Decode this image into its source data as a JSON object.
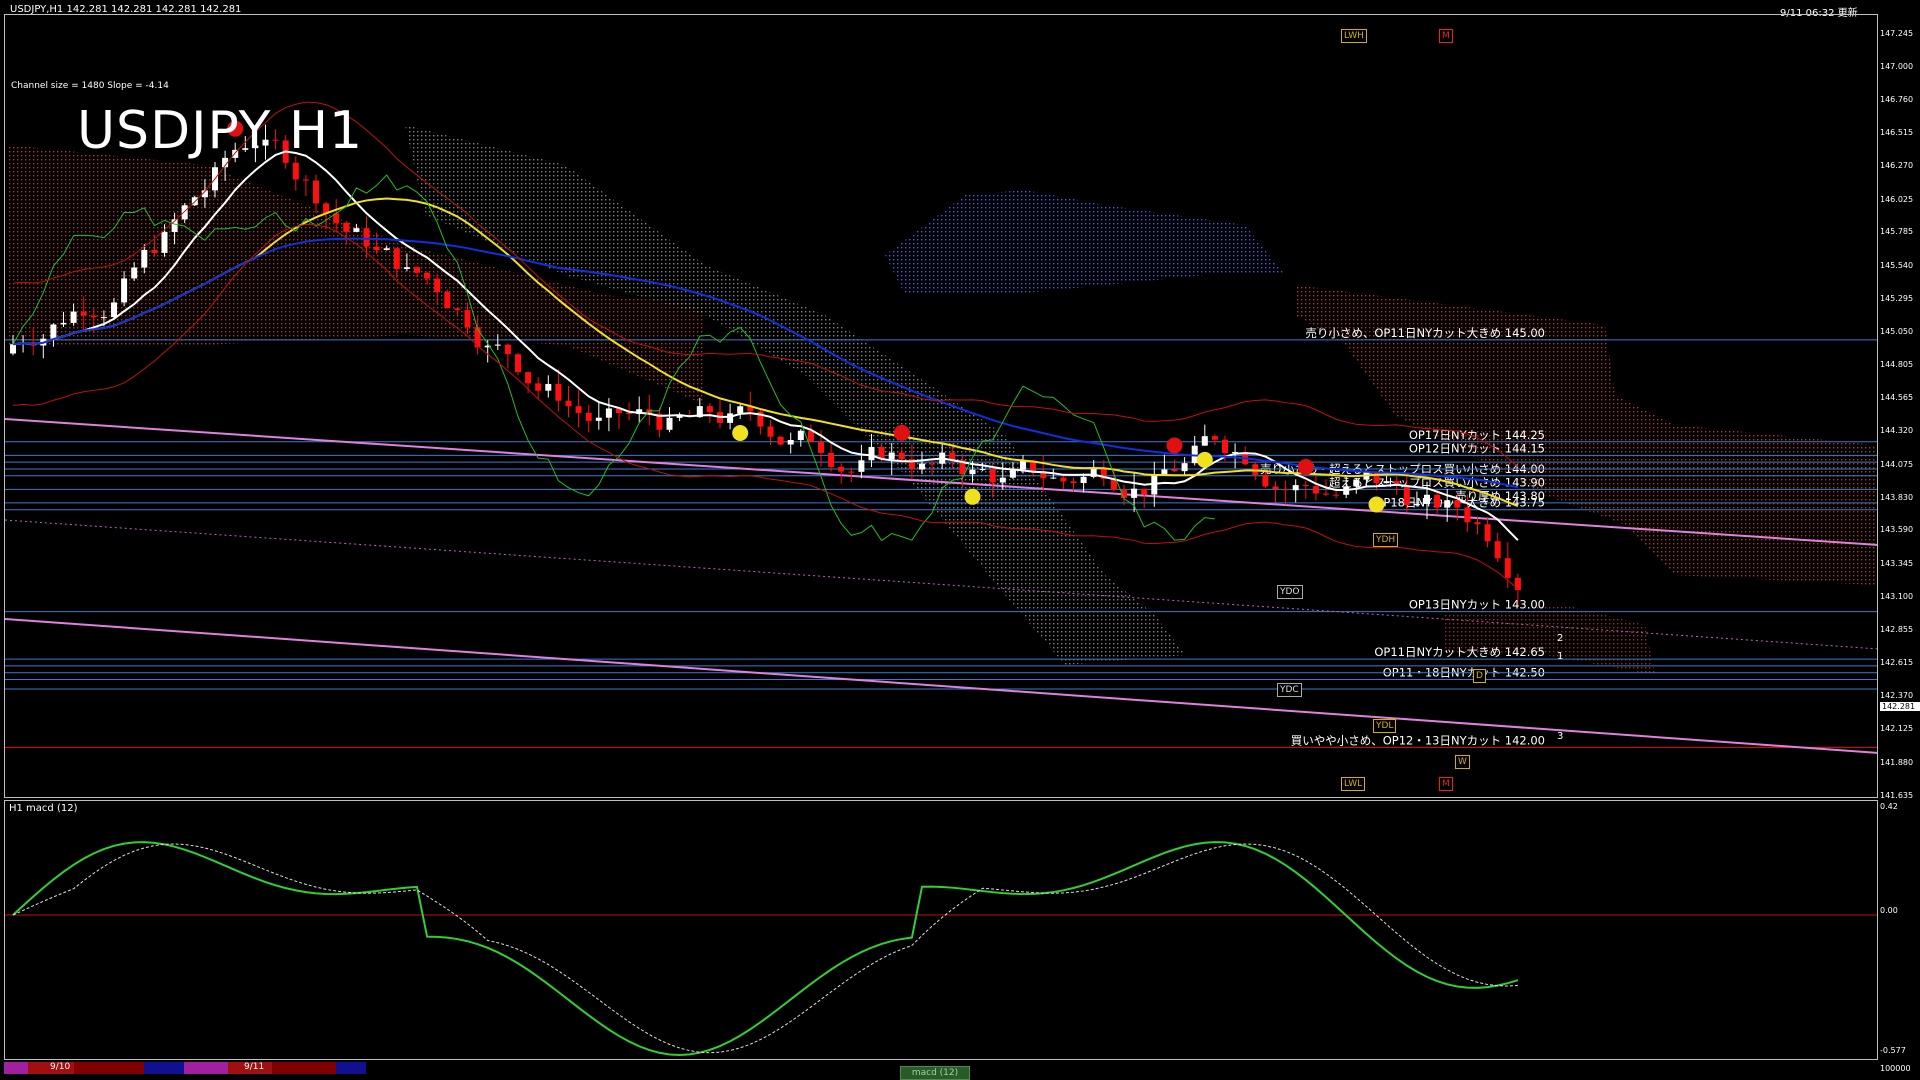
{
  "header": {
    "symbol_info": "USDJPY,H1  142.281 142.281 142.281 142.281",
    "channel_info": "Channel size = 1480 Slope = -4.14",
    "datetime": "9/11 06:32 更新",
    "big_title": "USDJPY H1"
  },
  "subwindow": {
    "title": "H1  macd (12)",
    "axis_top": "0.42",
    "axis_zero": "0.00",
    "axis_bottom": "-0.577",
    "axis_vol": "100000"
  },
  "price_axis": [
    "147.245",
    "147.000",
    "146.760",
    "146.515",
    "146.270",
    "146.025",
    "145.785",
    "145.540",
    "145.295",
    "145.050",
    "144.805",
    "144.565",
    "144.320",
    "144.075",
    "143.830",
    "143.590",
    "143.345",
    "143.100",
    "142.855",
    "142.615",
    "142.370",
    "142.125",
    "141.880",
    "141.635"
  ],
  "current_price": "142.281",
  "annotations": [
    {
      "text": "売り小さめ、OP11日NYカット大きめ 145.00",
      "price": 145.0
    },
    {
      "text": "OP17日NYカット 144.25",
      "price": 144.25
    },
    {
      "text": "OP12日NYカット 144.15",
      "price": 144.15
    },
    {
      "text": "売り小さめ・超えるとストップロス買い小さめ 144.00",
      "price": 144.0
    },
    {
      "text": "超えるとストップロス買い小さめ 143.90",
      "price": 143.9
    },
    {
      "text": "売り厚め 143.80",
      "price": 143.8
    },
    {
      "text": "OP18日NYカット大きめ 143.75",
      "price": 143.75
    },
    {
      "text": "OP13日NYカット 143.00",
      "price": 143.0
    },
    {
      "text": "OP11日NYカット大きめ 142.65",
      "price": 142.65
    },
    {
      "text": "OP11・18日NYカット 142.50",
      "price": 142.5
    },
    {
      "text": "買いやや小さめ、OP12・13日NYカット 142.00",
      "price": 142.0
    }
  ],
  "level_tags": [
    "LWH",
    "M",
    "YDH",
    "YDO",
    "YDC",
    "YDL",
    "LWL",
    "D",
    "W",
    "M"
  ],
  "channel_numbers": [
    "2",
    "1",
    "3"
  ],
  "bottom_strip": {
    "dates": [
      "9/10",
      "9/11"
    ],
    "tab": "macd (12)"
  },
  "colors": {
    "background": "#000000",
    "bull_candle": "#ffffff",
    "bear_candle": "#ff1010",
    "ma_fast": "#ffffff",
    "ma_mid": "#f0e020",
    "ma_slow": "#1030e0",
    "kumo_bull": "#3a6cff",
    "kumo_bear": "#e04020",
    "h_lines": "#3a7ad0",
    "channel": "#e080e0",
    "macd_up": "#30d030",
    "macd_down": "#f080b0"
  }
}
